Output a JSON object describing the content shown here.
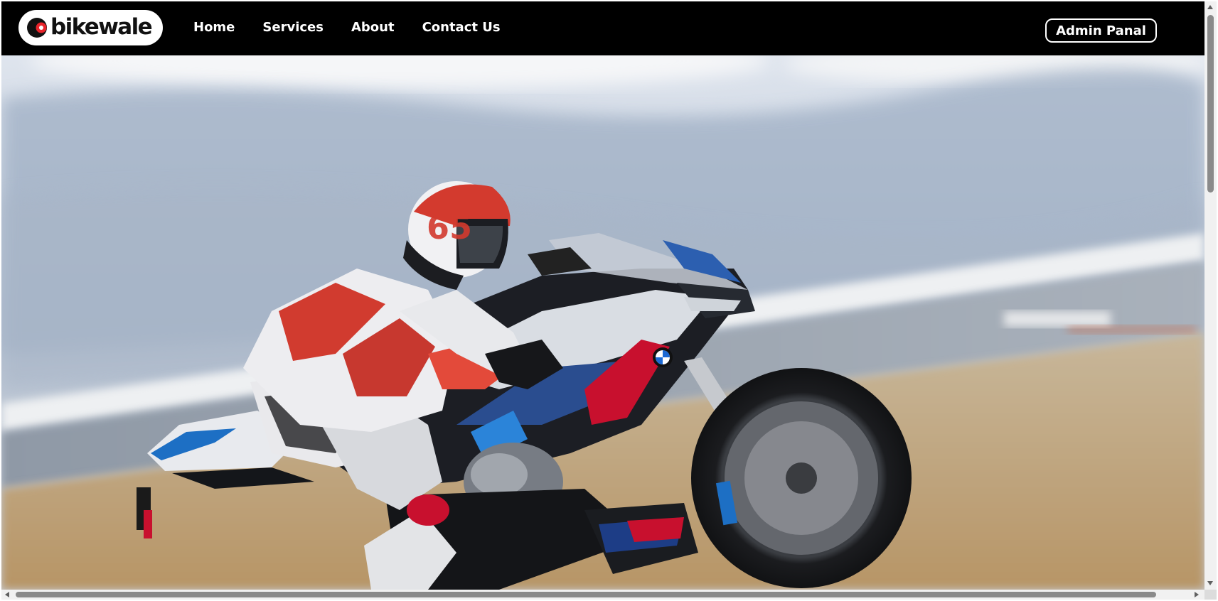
{
  "brand": {
    "logo_text": "bikewale",
    "logo_icon": "bikewale-logo-icon"
  },
  "nav": {
    "links": [
      {
        "label": "Home"
      },
      {
        "label": "Services"
      },
      {
        "label": "About"
      },
      {
        "label": "Contact Us"
      }
    ],
    "admin_button_label": "Admin Panal"
  },
  "hero": {
    "image": "motorcycle-racer-photo"
  },
  "colors": {
    "navbar_bg": "#000000",
    "nav_text": "#ffffff",
    "logo_bg": "#ffffff",
    "logo_accent": "#e8232a"
  }
}
